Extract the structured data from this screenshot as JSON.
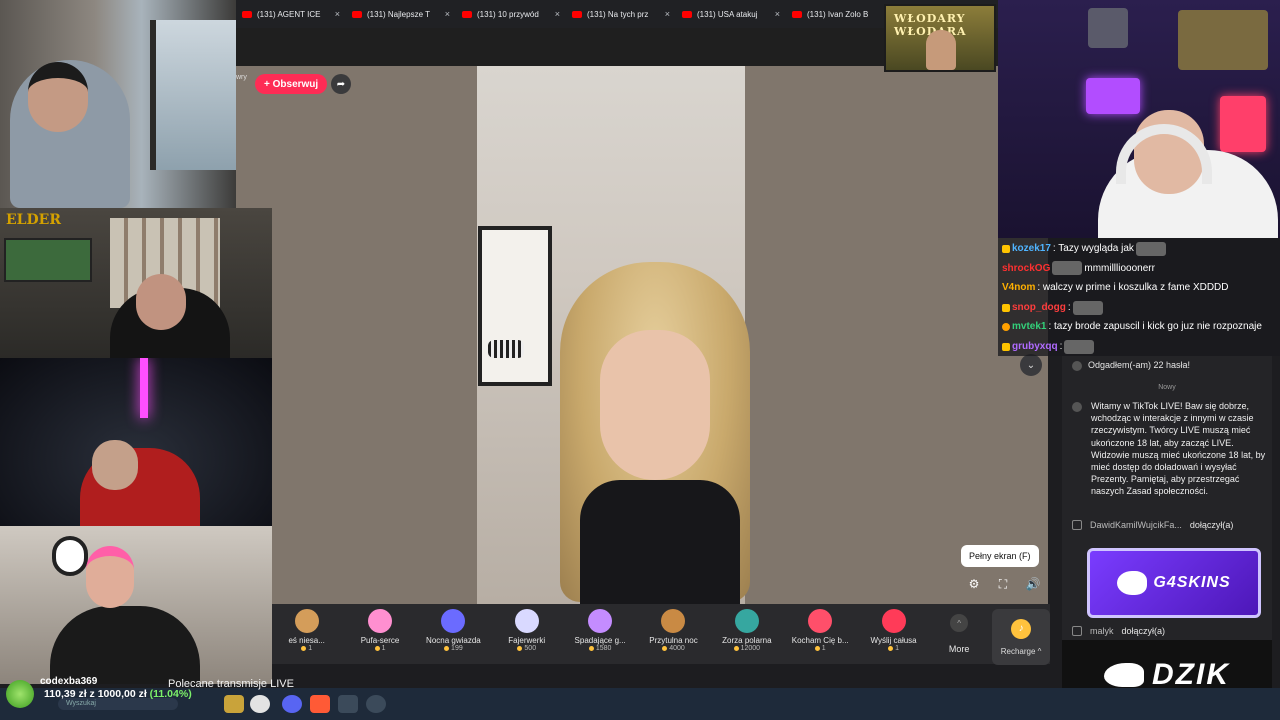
{
  "tabs": [
    {
      "label": "(131) AGENT ICE"
    },
    {
      "label": "(131) Najlepsze T"
    },
    {
      "label": "(131) 10 przywód"
    },
    {
      "label": "(131) Na tych prz"
    },
    {
      "label": "(131) USA atakuj"
    },
    {
      "label": "(131) Ivan Zolo B"
    }
  ],
  "tab_close_glyph": "×",
  "stream": {
    "streamer_name_fragment": "wry",
    "follow_label": "+ Obserwuj",
    "share_icon": "share-icon",
    "fullscreen_tooltip": "Pełny ekran (F)"
  },
  "gifts": [
    {
      "name": "eś niesa...",
      "price": "1",
      "color": "#d49d5a"
    },
    {
      "name": "Pufa-serce",
      "price": "1",
      "color": "#ff8fd0"
    },
    {
      "name": "Nocna gwiazda",
      "price": "199",
      "color": "#6b6bff"
    },
    {
      "name": "Fajerwerki",
      "price": "500",
      "color": "#d9d9ff"
    },
    {
      "name": "Spadające g...",
      "price": "1580",
      "color": "#c48cff"
    },
    {
      "name": "Przytulna noc",
      "price": "4000",
      "color": "#c98a44"
    },
    {
      "name": "Zorza polarna",
      "price": "12000",
      "color": "#36a7a0"
    },
    {
      "name": "Kocham Cię b...",
      "price": "1",
      "color": "#ff4f6a"
    },
    {
      "name": "Wyślij całusa",
      "price": "1",
      "color": "#ff3b58"
    }
  ],
  "gift_more_label": "More",
  "recharge_label": "Recharge ^",
  "overlay_chat": [
    {
      "nick": "kozek17",
      "nick_color": "#4fb4ff",
      "text": ": Tazy wygląda jak",
      "emote": true
    },
    {
      "nick": "shrockOG",
      "nick_color": "#ff3030",
      "text": "mmmillliooonerr",
      "emote": true
    },
    {
      "nick": "V4nom",
      "nick_color": "#ffb000",
      "text": ": walczy w prime i koszulka z fame XDDDD",
      "emote": false
    },
    {
      "nick": "snop_dogg",
      "nick_color": "#ff3d3d",
      "text": ":",
      "emote": true
    },
    {
      "nick": "mvtek1",
      "nick_color": "#33d07a",
      "text": ": tazy brode zapuscil i kick go juz nie rozpoznaje",
      "emote": false
    },
    {
      "nick": "grubyxqq",
      "nick_color": "#b06bff",
      "text": ":",
      "emote": true
    }
  ],
  "tiktok_chat": {
    "guess_line": "Odgadłem(-am) 22 hasła!",
    "separator_label": "Nowy",
    "system_message": "Witamy w TikTok LIVE! Baw się dobrze, wchodząc w interakcje z innymi w czasie rzeczywistym. Twórcy LIVE muszą mieć ukończone 18 lat, aby zacząć LIVE. Widzowie muszą mieć ukończone 18 lat, by mieć dostęp do doładowań i wysyłać Prezenty. Pamiętaj, aby przestrzegać naszych Zasad społeczności.",
    "joins": [
      {
        "name": "DawidKamilWujcikFa...",
        "action": "dołączył(a)"
      },
      {
        "name": "malyk",
        "action": "dołączył(a)"
      }
    ]
  },
  "sponsor_label": "G4SKINS",
  "dzik_label": "DZIK",
  "banner_text": "WŁODARY WŁODARA",
  "recommend_label": "Polecane transmisje LIVE",
  "goal": {
    "name": "codexba369",
    "value": "110,39 zł z 1000,00 zł",
    "pct": "(11.04%)"
  },
  "taskbar": {
    "search_placeholder": "Wyszukaj"
  },
  "colors": {
    "accent": "#fe2c55",
    "coin": "#ffc23d",
    "sponsor": "#7a3cff"
  }
}
